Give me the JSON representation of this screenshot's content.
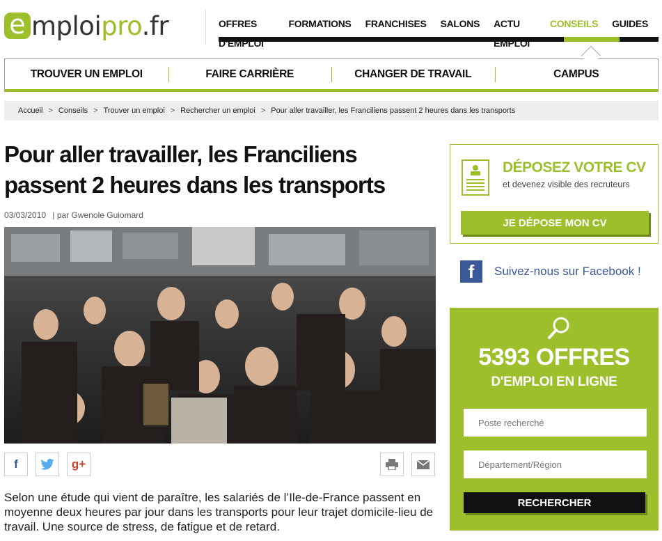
{
  "logo": {
    "e": "e",
    "mploi": "mploi",
    "pro": "pro",
    "fr": ".fr"
  },
  "topnav": {
    "items": [
      "OFFRES D'EMPLOI",
      "FORMATIONS",
      "FRANCHISES",
      "SALONS",
      "ACTU EMPLOI",
      "CONSEILS",
      "GUIDES"
    ],
    "active": "CONSEILS"
  },
  "subnav": {
    "items": [
      "TROUVER UN EMPLOI",
      "FAIRE CARRIÈRE",
      "CHANGER DE TRAVAIL",
      "CAMPUS"
    ]
  },
  "breadcrumb": {
    "items": [
      "Accueil",
      "Conseils",
      "Trouver un emploi",
      "Rechercher un emploi",
      "Pour aller travailler, les Franciliens passent 2 heures dans les transports"
    ],
    "separator": ">"
  },
  "article": {
    "title": "Pour aller travailler, les Franciliens passent 2 heures dans les transports",
    "date": "03/03/2010",
    "author_prefix": "| par",
    "author": "Gwenole Guiomard",
    "body": "Selon une étude qui vient de paraître, les salariés de l’Ile-de-France passent en moyenne deux heures par jour dans les transports pour leur trajet domicile-lieu de travail. Une source de stress, de fatigue et de retard."
  },
  "share": {
    "facebook": "f",
    "googleplus": "g+"
  },
  "sidebar": {
    "cv": {
      "title": "DÉPOSEZ VOTRE CV",
      "subtitle": "et devenez visible des recruteurs",
      "button": "JE DÉPOSE MON CV"
    },
    "facebook": {
      "text": "Suivez-nous sur Facebook !"
    },
    "offers": {
      "count": "5393 OFFRES",
      "label": "D'EMPLOI EN LIGNE",
      "job_placeholder": "Poste recherché",
      "location_placeholder": "Département/Région",
      "button": "RECHERCHER"
    }
  },
  "colors": {
    "brand_green": "#9cbf2b",
    "facebook_blue": "#3b5998",
    "gplus_red": "#c8412e",
    "twitter_blue": "#55acee"
  }
}
